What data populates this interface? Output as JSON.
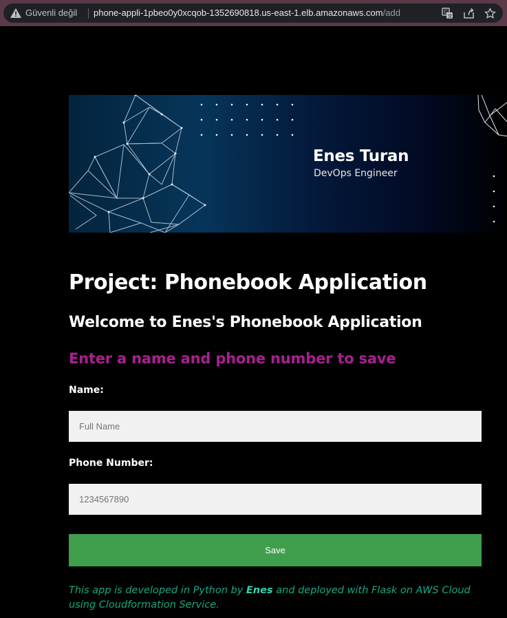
{
  "browser": {
    "security_label": "Güvenli değil",
    "url_host": "phone-appli-1pbeo0y0xcqob-1352690818.us-east-1.elb.amazonaws.com",
    "url_path": "/add",
    "icons": [
      "warning-icon",
      "translate-icon",
      "share-icon",
      "bookmark-star-icon"
    ]
  },
  "banner": {
    "name": "Enes Turan",
    "role": "DevOps Engineer"
  },
  "page": {
    "title": "Project: Phonebook Application",
    "welcome": "Welcome to Enes's Phonebook Application",
    "instruction": "Enter a name and phone number to save"
  },
  "form": {
    "name_label": "Name:",
    "name_placeholder": "Full Name",
    "phone_label": "Phone Number:",
    "phone_placeholder": "1234567890",
    "save_label": "Save"
  },
  "footer": {
    "text_before": "This app is developed in Python by ",
    "author": "Enes",
    "text_after": " and deployed with Flask on AWS Cloud using Cloudformation Service."
  },
  "colors": {
    "instruction": "#a8218f",
    "save_button": "#3f9e4b",
    "footer": "#16a984",
    "footer_author": "#34d2b2"
  }
}
